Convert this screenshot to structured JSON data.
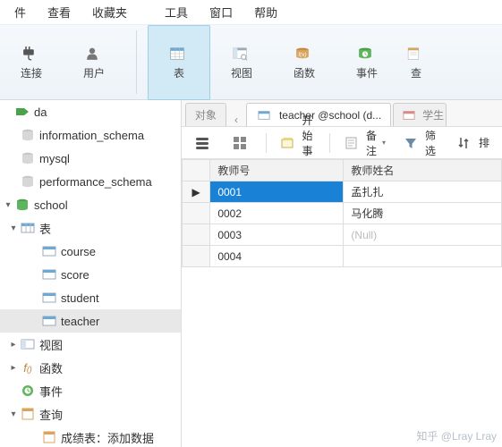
{
  "menu": {
    "file": "件",
    "view": "查看",
    "fav": "收藏夹",
    "tools": "工具",
    "window": "窗口",
    "help": "帮助"
  },
  "ribbon": {
    "connect": "连接",
    "user": "用户",
    "table": "表",
    "view": "视图",
    "func": "函数",
    "event": "事件",
    "query": "查"
  },
  "tree": {
    "da": "da",
    "info_schema": "information_schema",
    "mysql": "mysql",
    "perf_schema": "performance_schema",
    "school": "school",
    "tables_label": "表",
    "tables": [
      "course",
      "score",
      "student",
      "teacher"
    ],
    "views": "视图",
    "funcs": "函数",
    "events": "事件",
    "queries": "查询",
    "q1": "成绩表：添加数据"
  },
  "tabs": {
    "obj": "对象",
    "teacher": "teacher @school (d...",
    "student": "学生"
  },
  "etbar": {
    "start_tx": "开始事务",
    "remark": "备注",
    "filter": "筛选",
    "sort": "排"
  },
  "grid": {
    "headers": [
      "教师号",
      "教师姓名"
    ],
    "rows": [
      {
        "id": "0001",
        "name": "孟扎扎",
        "marker": "▶",
        "sel": true
      },
      {
        "id": "0002",
        "name": "马化腾",
        "marker": ""
      },
      {
        "id": "0003",
        "name": "(Null)",
        "marker": "",
        "null": true
      },
      {
        "id": "0004",
        "name": "",
        "marker": ""
      }
    ]
  },
  "watermark": "知乎 @Lray Lray"
}
